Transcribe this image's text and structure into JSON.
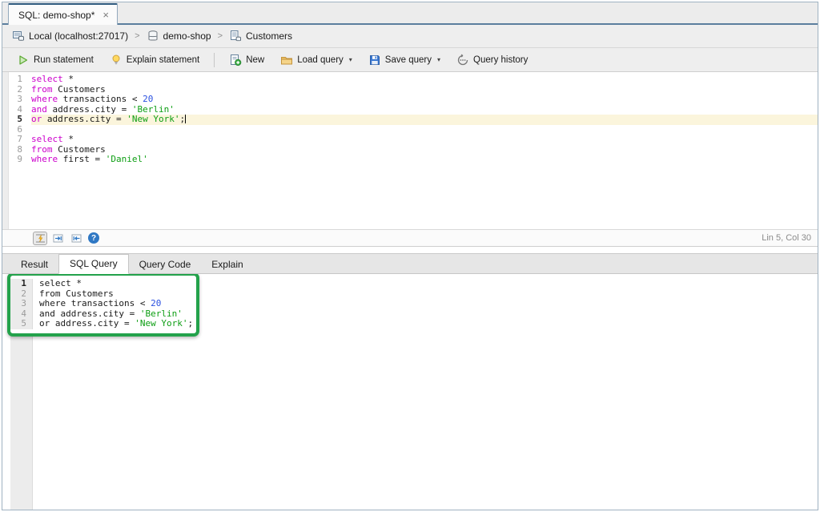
{
  "window": {
    "tab_title": "SQL: demo-shop*",
    "close_glyph": "×"
  },
  "breadcrumb": {
    "connection": "Local (localhost:27017)",
    "separator": ">",
    "database": "demo-shop",
    "collection": "Customers"
  },
  "toolbar": {
    "run_label": "Run statement",
    "explain_label": "Explain statement",
    "new_label": "New",
    "load_label": "Load query",
    "save_label": "Save query",
    "history_label": "Query history",
    "dropdown_glyph": "▾"
  },
  "editor_footer": {
    "status": "Lin 5, Col 30",
    "help_glyph": "?"
  },
  "bottom": {
    "tabs": [
      "Result",
      "SQL Query",
      "Query Code",
      "Explain"
    ],
    "active_tab": "SQL Query"
  },
  "code": {
    "top_lines": [
      {
        "num": "1",
        "tokens": [
          [
            "kw",
            "select"
          ],
          [
            "pl",
            " *"
          ]
        ]
      },
      {
        "num": "2",
        "tokens": [
          [
            "kw",
            "from"
          ],
          [
            "pl",
            " Customers"
          ]
        ]
      },
      {
        "num": "3",
        "tokens": [
          [
            "kw",
            "where"
          ],
          [
            "pl",
            " transactions < "
          ],
          [
            "num",
            "20"
          ]
        ]
      },
      {
        "num": "4",
        "tokens": [
          [
            "kw",
            "and"
          ],
          [
            "pl",
            " address.city = "
          ],
          [
            "str",
            "'Berlin'"
          ]
        ]
      },
      {
        "num": "5",
        "tokens": [
          [
            "kw",
            "or"
          ],
          [
            "pl",
            " address.city = "
          ],
          [
            "str",
            "'New York'"
          ],
          [
            "pl",
            ";"
          ]
        ],
        "current": true,
        "cursor": true
      },
      {
        "num": "6",
        "tokens": []
      },
      {
        "num": "7",
        "tokens": [
          [
            "kw",
            "select"
          ],
          [
            "pl",
            " *"
          ]
        ]
      },
      {
        "num": "8",
        "tokens": [
          [
            "kw",
            "from"
          ],
          [
            "pl",
            " Customers"
          ]
        ]
      },
      {
        "num": "9",
        "tokens": [
          [
            "kw",
            "where"
          ],
          [
            "pl",
            " first = "
          ],
          [
            "str",
            "'Daniel'"
          ]
        ]
      }
    ],
    "bottom_lines": [
      {
        "num": "1",
        "tokens": [
          [
            "kw",
            "select"
          ],
          [
            "pl",
            " *"
          ]
        ],
        "current": true
      },
      {
        "num": "2",
        "tokens": [
          [
            "kw",
            "from"
          ],
          [
            "pl",
            " Customers"
          ]
        ]
      },
      {
        "num": "3",
        "tokens": [
          [
            "kw",
            "where"
          ],
          [
            "pl",
            " transactions < "
          ],
          [
            "num",
            "20"
          ]
        ]
      },
      {
        "num": "4",
        "tokens": [
          [
            "kw",
            "and"
          ],
          [
            "pl",
            " address.city = "
          ],
          [
            "str",
            "'Berlin'"
          ]
        ]
      },
      {
        "num": "5",
        "tokens": [
          [
            "kw",
            "or"
          ],
          [
            "pl",
            " address.city = "
          ],
          [
            "str",
            "'New York'"
          ],
          [
            "pl",
            ";"
          ]
        ]
      }
    ]
  },
  "colors": {
    "keyword": "#cc00cc",
    "keyword_bottom": "#1a1a1a",
    "number": "#2a50e0",
    "string": "#0d9e13",
    "current_line_bg": "#fbf5dc",
    "annotation_green": "#23a24b"
  }
}
